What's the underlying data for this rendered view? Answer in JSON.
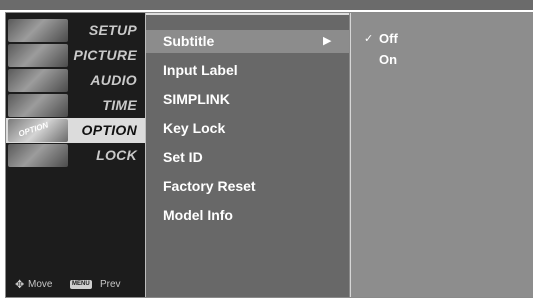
{
  "categories": [
    {
      "label": "SETUP"
    },
    {
      "label": "PICTURE"
    },
    {
      "label": "AUDIO"
    },
    {
      "label": "TIME"
    },
    {
      "label": "OPTION",
      "badge": "OPTION"
    },
    {
      "label": "LOCK"
    }
  ],
  "active_category": "OPTION",
  "hints": {
    "move_icon": "move-arrows-icon",
    "move": "Move",
    "menu_key": "MENU",
    "prev": "Prev"
  },
  "menu": {
    "items": [
      {
        "label": "Subtitle"
      },
      {
        "label": "Input Label"
      },
      {
        "label": "SIMPLINK"
      },
      {
        "label": "Key Lock"
      },
      {
        "label": "Set ID"
      },
      {
        "label": "Factory Reset"
      },
      {
        "label": "Model Info"
      }
    ],
    "selected": "Subtitle",
    "submenu_arrow": "▶"
  },
  "options": [
    {
      "label": "Off",
      "checked": true,
      "check_mark": "✓"
    },
    {
      "label": "On",
      "checked": false
    }
  ],
  "colors": {
    "active_category_bg": "#dcdcdc",
    "menu_bg": "#686868",
    "selected_item_bg": "#8c8c8c",
    "options_bg": "#8d8d8d"
  }
}
